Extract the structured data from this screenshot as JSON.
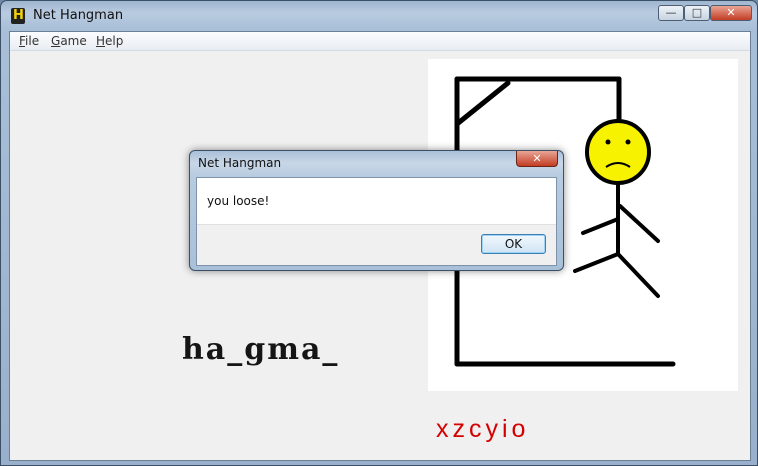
{
  "window": {
    "title": "Net Hangman",
    "app_icon_glyph": "H",
    "controls": {
      "minimize": "—",
      "maximize": "□",
      "close": "✕"
    }
  },
  "menu": {
    "items": [
      {
        "label": "File"
      },
      {
        "label": "Game"
      },
      {
        "label": "Help"
      }
    ]
  },
  "game": {
    "word_display": "ha_gma_",
    "guessed_letters": "xzcyio"
  },
  "dialog": {
    "title": "Net Hangman",
    "message": "you loose!",
    "ok_label": "OK",
    "close_glyph": "✕"
  },
  "colors": {
    "guessed_letters": "#d40000",
    "face": "#f7f200",
    "stroke": "#000000"
  }
}
